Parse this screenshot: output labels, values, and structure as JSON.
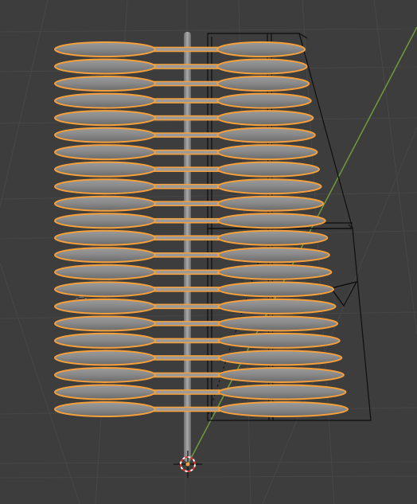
{
  "viewport": {
    "view_type": "3D Viewport",
    "background_color": "#3d3d3d",
    "grid_color": "#474747",
    "selection_outline_color": "#f5a03c",
    "y_axis_color": "#6e9b3a",
    "mesh_fill_color": "#808080",
    "wire_color": "#101010"
  },
  "objects": [
    {
      "name_icon": "selected-mesh-discs",
      "kind": "array-of-ellipses",
      "selected": true,
      "disc_count": 22
    },
    {
      "name_icon": "vertical-pole",
      "kind": "cylinder",
      "selected": false
    },
    {
      "name_icon": "camera-frustum",
      "kind": "camera",
      "selected": false
    },
    {
      "name_icon": "empty-object",
      "kind": "empty",
      "selected": false
    },
    {
      "name_icon": "3d-cursor-icon",
      "kind": "3d-cursor",
      "selected": false
    }
  ]
}
